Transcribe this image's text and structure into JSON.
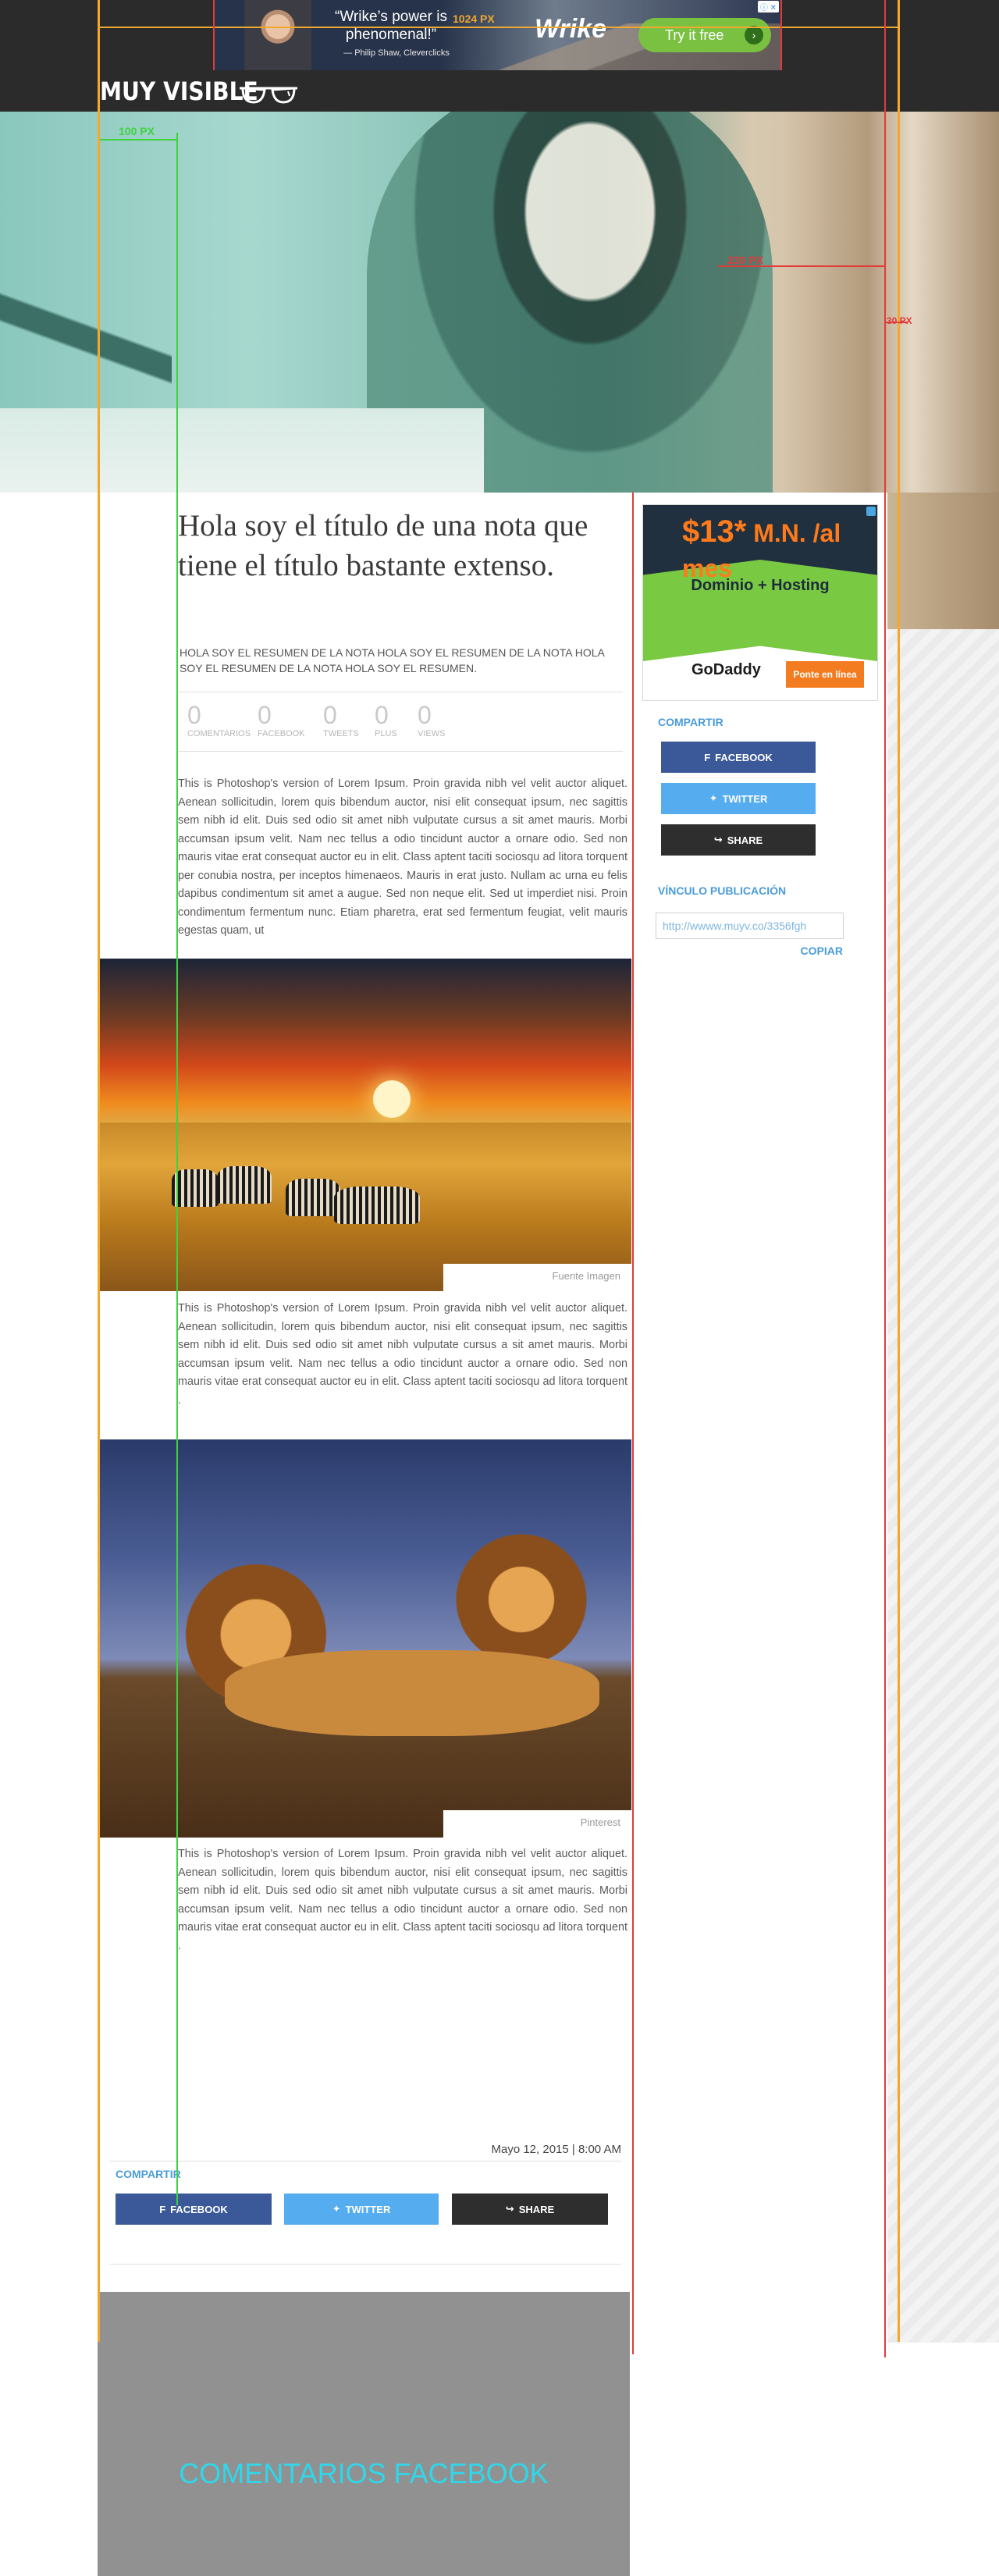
{
  "ad_top": {
    "quote": "“Wrike’s power is phenomenal!”",
    "author": "— Philip Shaw, Cleverclicks",
    "brand": "Wrike",
    "cta": "Try it free",
    "arrow": "›",
    "adchoice": "ⓘ ✕"
  },
  "header": {
    "logo": "MUY VISIBLE",
    "logo_icon": "glasses-icon"
  },
  "guides": {
    "label_1024": "1024 PX",
    "label_100": "100 PX",
    "label_230": "230 PX",
    "label_side": "30 PX",
    "colors": {
      "yellow": "#f0a830",
      "red": "#e13b3b",
      "green": "#3fd23f"
    }
  },
  "article": {
    "title": "Hola soy el título de una nota que tiene el título bastante extenso.",
    "summary": "HOLA SOY EL RESUMEN DE LA NOTA  HOLA SOY EL RESUMEN DE LA NOTA  HOLA SOY EL RESUMEN DE LA NOTA  HOLA SOY EL RESUMEN.",
    "stats": [
      {
        "value": "0",
        "label": "COMENTARIOS"
      },
      {
        "value": "0",
        "label": "FACEBOOK"
      },
      {
        "value": "0",
        "label": "TWEETS"
      },
      {
        "value": "0",
        "label": "PLUS"
      },
      {
        "value": "0",
        "label": "VIEWS"
      }
    ],
    "paragraph_1": "This is Photoshop's version  of Lorem Ipsum. Proin gravida nibh vel velit auctor aliquet. Aenean sollicitudin, lorem quis bibendum auctor, nisi elit consequat ipsum, nec sagittis sem nibh id elit. Duis sed odio sit amet nibh vulputate cursus a sit amet mauris. Morbi accumsan ipsum velit. Nam nec tellus a odio tincidunt auctor a ornare odio. Sed non  mauris vitae erat consequat auctor eu in elit. Class aptent taciti sociosqu ad litora torquent per conubia nostra, per inceptos himenaeos. Mauris in erat justo. Nullam ac urna eu felis dapibus condimentum sit amet a augue. Sed non neque elit. Sed ut imperdiet nisi. Proin condimentum fermentum nunc. Etiam pharetra, erat sed fermentum feugiat, velit mauris egestas quam, ut",
    "image_1_caption": "Fuente Imagen",
    "paragraph_2": "This is Photoshop's version  of Lorem Ipsum. Proin gravida nibh vel velit auctor aliquet. Aenean sollicitudin, lorem quis bibendum auctor, nisi elit consequat ipsum, nec sagittis sem nibh id elit. Duis sed odio sit amet nibh vulputate cursus a sit amet mauris. Morbi accumsan ipsum velit. Nam nec tellus a odio tincidunt auctor a ornare odio. Sed non  mauris vitae erat consequat auctor eu in elit. Class aptent taciti sociosqu ad litora torquent .",
    "image_2_caption": "Pinterest",
    "paragraph_3": "This is Photoshop's version  of Lorem Ipsum. Proin gravida nibh vel velit auctor aliquet. Aenean sollicitudin, lorem quis bibendum auctor, nisi elit consequat ipsum, nec sagittis sem nibh id elit. Duis sed odio sit amet nibh vulputate cursus a sit amet mauris. Morbi accumsan ipsum velit. Nam nec tellus a odio tincidunt auctor a ornare odio. Sed non  mauris vitae erat consequat auctor eu in elit. Class aptent taciti sociosqu ad litora torquent .",
    "date": "Mayo 12, 2015 | 8:00 AM"
  },
  "share": {
    "label": "COMPARTIR",
    "facebook": "FACEBOOK",
    "twitter": "TWITTER",
    "share": "SHARE",
    "icons": {
      "facebook": "facebook-icon",
      "twitter": "twitter-icon",
      "share": "share-arrow-icon"
    },
    "colors": {
      "facebook": "#3b5998",
      "twitter": "#55acee",
      "share": "#2e2e2e"
    }
  },
  "sidebar_ad": {
    "price": "$13",
    "price_suffix": "*",
    "price_unit": " M.N. /al mes",
    "headline": "Dominio + Hosting",
    "brand": "GoDaddy",
    "cta": "Ponte en línea"
  },
  "sidebar": {
    "share_label": "COMPARTIR",
    "link_label": "VÍNCULO PUBLICACIÓN",
    "link_url": "http://wwww.muyv.co/3356fgh",
    "copy_label": "COPIAR"
  },
  "comments": {
    "title": "COMENTARIOS FACEBOOK",
    "title_color": "#2fd7ea"
  }
}
